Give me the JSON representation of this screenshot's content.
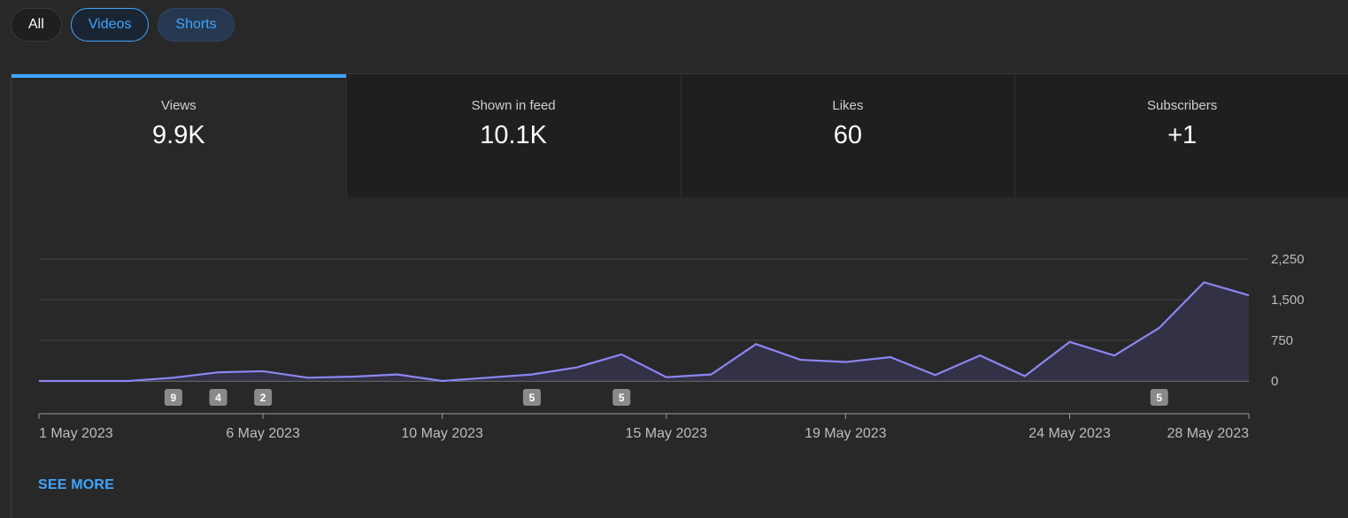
{
  "filters": {
    "all": "All",
    "videos": "Videos",
    "shorts": "Shorts"
  },
  "metrics": [
    {
      "label": "Views",
      "value": "9.9K",
      "active": true
    },
    {
      "label": "Shown in feed",
      "value": "10.1K",
      "active": false
    },
    {
      "label": "Likes",
      "value": "60",
      "active": false
    },
    {
      "label": "Subscribers",
      "value": "+1",
      "active": false
    }
  ],
  "colors": {
    "accent": "#3ea6ff",
    "line": "#8c86f2",
    "fill": "#35324a"
  },
  "see_more": "SEE MORE",
  "chart_data": {
    "type": "area",
    "x": [
      "2023-05-01",
      "2023-05-02",
      "2023-05-03",
      "2023-05-04",
      "2023-05-05",
      "2023-05-06",
      "2023-05-07",
      "2023-05-08",
      "2023-05-09",
      "2023-05-10",
      "2023-05-11",
      "2023-05-12",
      "2023-05-13",
      "2023-05-14",
      "2023-05-15",
      "2023-05-16",
      "2023-05-17",
      "2023-05-18",
      "2023-05-19",
      "2023-05-20",
      "2023-05-21",
      "2023-05-22",
      "2023-05-23",
      "2023-05-24",
      "2023-05-25",
      "2023-05-26",
      "2023-05-27",
      "2023-05-28"
    ],
    "values": [
      0,
      0,
      0,
      60,
      160,
      180,
      60,
      80,
      120,
      0,
      60,
      120,
      250,
      490,
      70,
      120,
      680,
      390,
      350,
      440,
      110,
      470,
      90,
      720,
      470,
      980,
      1820,
      1580
    ],
    "ylim": [
      0,
      2250
    ],
    "yticks": [
      "0",
      "750",
      "1,500",
      "2,250"
    ],
    "xtick_labels": [
      {
        "x": "2023-05-01",
        "label": "1 May 2023"
      },
      {
        "x": "2023-05-06",
        "label": "6 May 2023"
      },
      {
        "x": "2023-05-10",
        "label": "10 May 2023"
      },
      {
        "x": "2023-05-15",
        "label": "15 May 2023"
      },
      {
        "x": "2023-05-19",
        "label": "19 May 2023"
      },
      {
        "x": "2023-05-24",
        "label": "24 May 2023"
      },
      {
        "x": "2023-05-28",
        "label": "28 May 2023"
      }
    ],
    "markers": [
      {
        "x": "2023-05-04",
        "label": "9"
      },
      {
        "x": "2023-05-05",
        "label": "4"
      },
      {
        "x": "2023-05-06",
        "label": "2"
      },
      {
        "x": "2023-05-12",
        "label": "5"
      },
      {
        "x": "2023-05-14",
        "label": "5"
      },
      {
        "x": "2023-05-26",
        "label": "5"
      }
    ],
    "grid": true,
    "title": "",
    "xlabel": "",
    "ylabel": ""
  }
}
